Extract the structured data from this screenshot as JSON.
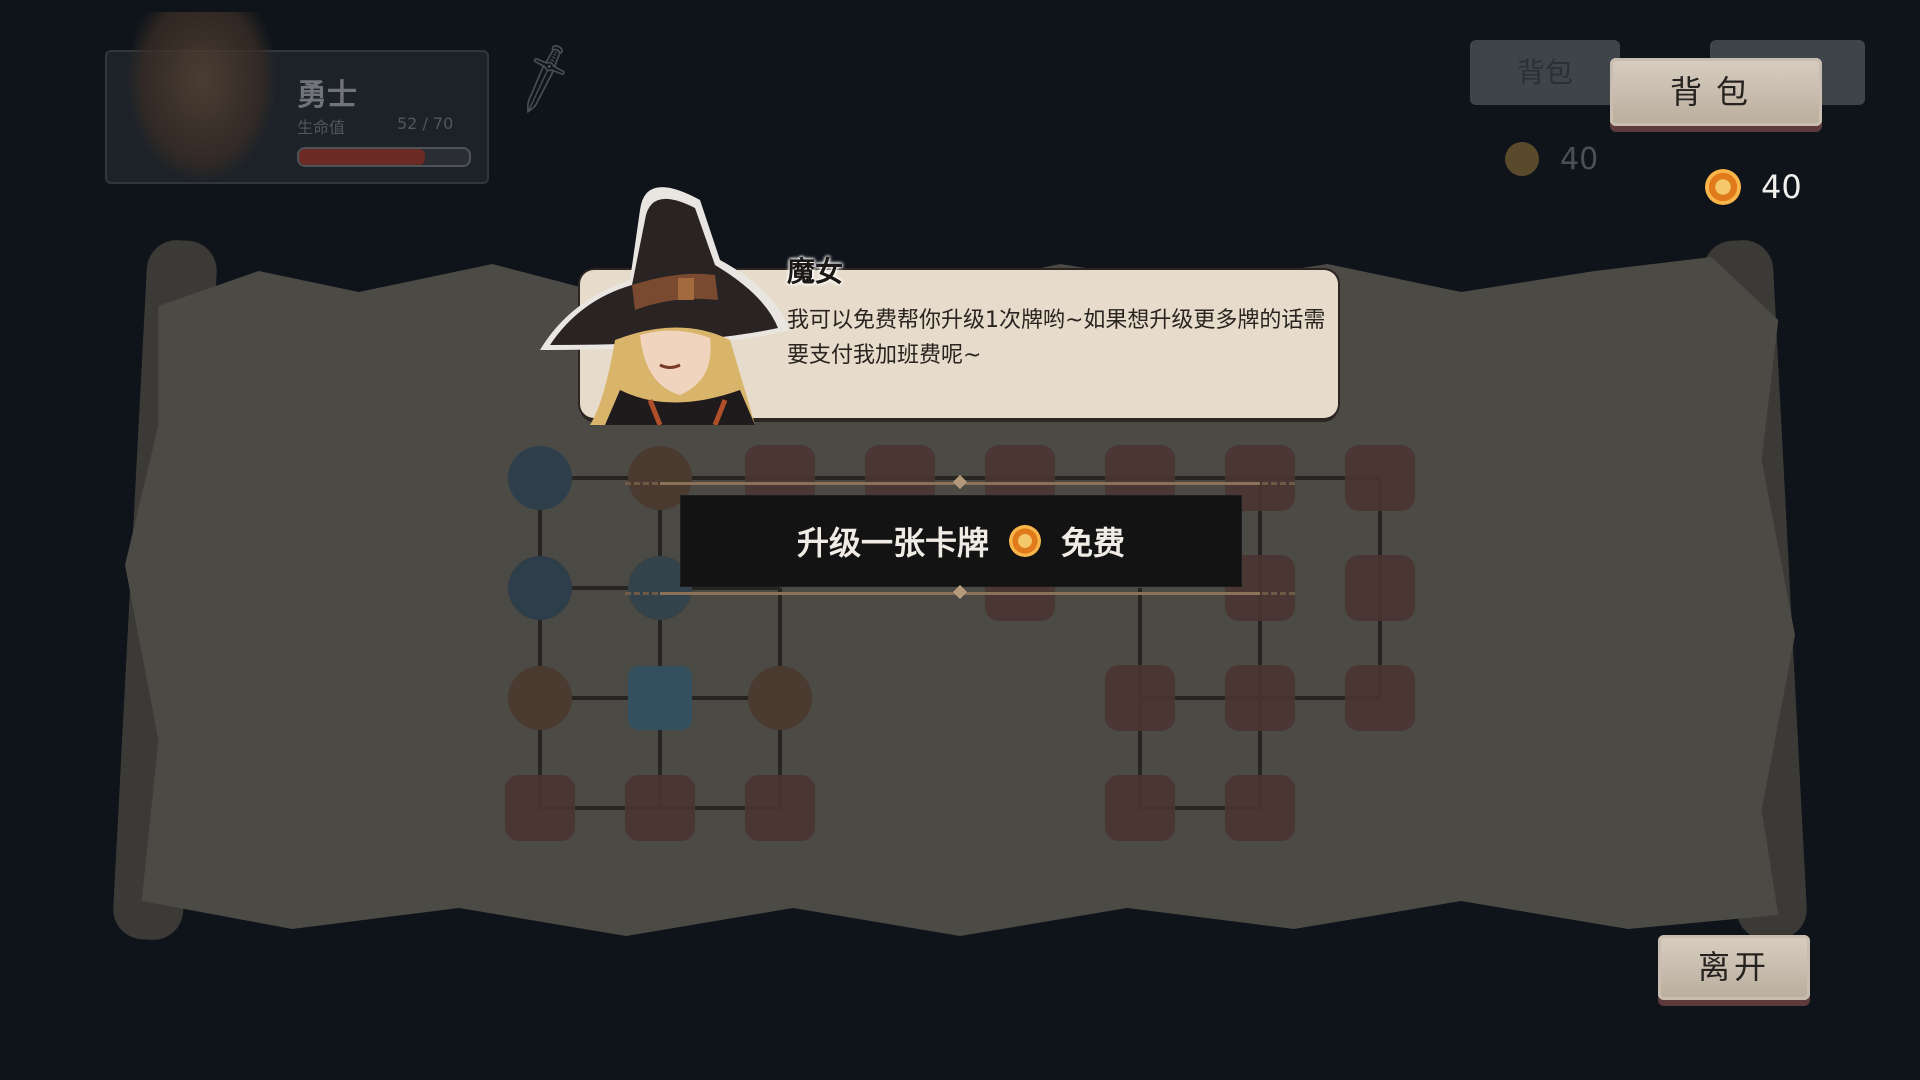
{
  "background": {
    "hero_name": "勇士",
    "hero_hp_label": "生命值",
    "hero_hp_value": "52 / 70",
    "hero_hp_fraction": 0.74,
    "bag_label": "背包",
    "gold": "40"
  },
  "dialog": {
    "speaker": "魔女",
    "text": "我可以免费帮你升级1次牌哟~如果想升级更多牌的话需要支付我加班费呢~"
  },
  "option": {
    "label": "升级一张卡牌",
    "cost_icon": "coin-icon",
    "cost": "免费"
  },
  "hud": {
    "bag_label": "背包",
    "gold_icon": "coin-icon",
    "gold": "40",
    "leave_label": "离开"
  },
  "colors": {
    "dialog_bg": "#e7dccb",
    "option_bg": "#131314",
    "button_bg": "#cbbfb0",
    "coin": "#e07a1b"
  }
}
